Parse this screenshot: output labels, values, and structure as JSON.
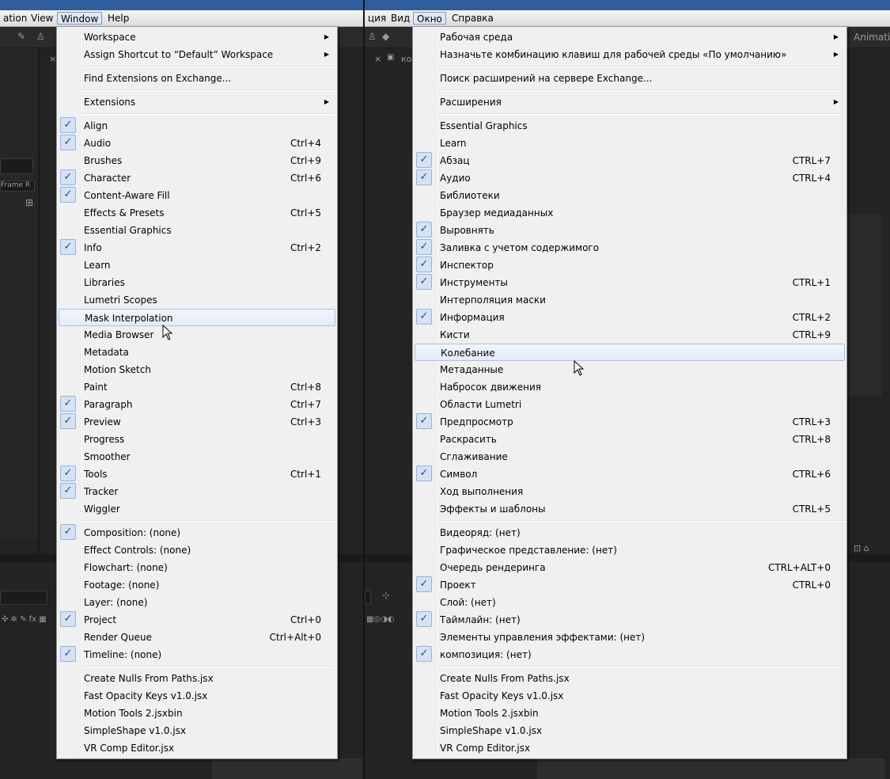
{
  "left": {
    "menubar": [
      "ation",
      "View",
      "Window",
      "Help"
    ],
    "active_menu": "Window",
    "bg_labels": {
      "frame": "Frame R",
      "x_mark": "×"
    },
    "menu": {
      "groups": [
        [
          {
            "label": "Workspace",
            "submenu": true
          },
          {
            "label": "Assign Shortcut to “Default” Workspace",
            "submenu": true
          }
        ],
        [
          {
            "label": "Find Extensions on Exchange..."
          }
        ],
        [
          {
            "label": "Extensions",
            "submenu": true
          }
        ],
        [
          {
            "label": "Align",
            "checked": true
          },
          {
            "label": "Audio",
            "checked": true,
            "shortcut": "Ctrl+4"
          },
          {
            "label": "Brushes",
            "shortcut": "Ctrl+9"
          },
          {
            "label": "Character",
            "checked": true,
            "shortcut": "Ctrl+6"
          },
          {
            "label": "Content-Aware Fill",
            "checked": true
          },
          {
            "label": "Effects & Presets",
            "shortcut": "Ctrl+5"
          },
          {
            "label": "Essential Graphics"
          },
          {
            "label": "Info",
            "checked": true,
            "shortcut": "Ctrl+2"
          },
          {
            "label": "Learn"
          },
          {
            "label": "Libraries"
          },
          {
            "label": "Lumetri Scopes"
          },
          {
            "label": "Mask Interpolation",
            "hover": true
          },
          {
            "label": "Media Browser"
          },
          {
            "label": "Metadata"
          },
          {
            "label": "Motion Sketch"
          },
          {
            "label": "Paint",
            "shortcut": "Ctrl+8"
          },
          {
            "label": "Paragraph",
            "checked": true,
            "shortcut": "Ctrl+7"
          },
          {
            "label": "Preview",
            "checked": true,
            "shortcut": "Ctrl+3"
          },
          {
            "label": "Progress"
          },
          {
            "label": "Smoother"
          },
          {
            "label": "Tools",
            "checked": true,
            "shortcut": "Ctrl+1"
          },
          {
            "label": "Tracker",
            "checked": true
          },
          {
            "label": "Wiggler"
          }
        ],
        [
          {
            "label": "Composition: (none)",
            "checked": true
          },
          {
            "label": "Effect Controls: (none)"
          },
          {
            "label": "Flowchart: (none)"
          },
          {
            "label": "Footage: (none)"
          },
          {
            "label": "Layer: (none)"
          },
          {
            "label": "Project",
            "checked": true,
            "shortcut": "Ctrl+0"
          },
          {
            "label": "Render Queue",
            "shortcut": "Ctrl+Alt+0"
          },
          {
            "label": "Timeline: (none)",
            "checked": true
          }
        ],
        [
          {
            "label": "Create Nulls From Paths.jsx"
          },
          {
            "label": "Fast Opacity Keys v1.0.jsx"
          },
          {
            "label": "Motion Tools 2.jsxbin"
          },
          {
            "label": "SimpleShape v1.0.jsx"
          },
          {
            "label": "VR Comp Editor.jsx"
          }
        ]
      ]
    }
  },
  "right": {
    "menubar": [
      "ция",
      "Вид",
      "Окно",
      "Справка"
    ],
    "active_menu": "Окно",
    "bg_labels": {
      "animation": "Animatio",
      "comp": "ко",
      "x_mark": "×"
    },
    "menu": {
      "groups": [
        [
          {
            "label": "Рабочая среда",
            "submenu": true
          },
          {
            "label": "Назначьте комбинацию клавиш для рабочей среды «По умолчанию»",
            "submenu": true
          }
        ],
        [
          {
            "label": "Поиск расширений на сервере Exchange..."
          }
        ],
        [
          {
            "label": "Расширения",
            "submenu": true
          }
        ],
        [
          {
            "label": "Essential Graphics"
          },
          {
            "label": "Learn"
          },
          {
            "label": "Абзац",
            "checked": true,
            "shortcut": "CTRL+7"
          },
          {
            "label": "Аудио",
            "checked": true,
            "shortcut": "CTRL+4"
          },
          {
            "label": "Библиотеки"
          },
          {
            "label": "Браузер медиаданных"
          },
          {
            "label": "Выровнять",
            "checked": true
          },
          {
            "label": "Заливка с учетом содержимого",
            "checked": true
          },
          {
            "label": "Инспектор",
            "checked": true
          },
          {
            "label": "Инструменты",
            "checked": true,
            "shortcut": "CTRL+1"
          },
          {
            "label": "Интерполяция маски"
          },
          {
            "label": "Информация",
            "checked": true,
            "shortcut": "CTRL+2"
          },
          {
            "label": "Кисти",
            "shortcut": "CTRL+9"
          },
          {
            "label": "Колебание",
            "hover": true
          },
          {
            "label": "Метаданные"
          },
          {
            "label": "Набросок движения"
          },
          {
            "label": "Области Lumetri"
          },
          {
            "label": "Предпросмотр",
            "checked": true,
            "shortcut": "CTRL+3"
          },
          {
            "label": "Раскрасить",
            "shortcut": "CTRL+8"
          },
          {
            "label": "Сглаживание"
          },
          {
            "label": "Символ",
            "checked": true,
            "shortcut": "CTRL+6"
          },
          {
            "label": "Ход выполнения"
          },
          {
            "label": "Эффекты и шаблоны",
            "shortcut": "CTRL+5"
          }
        ],
        [
          {
            "label": "Видеоряд: (нет)"
          },
          {
            "label": "Графическое представление: (нет)"
          },
          {
            "label": "Очередь рендеринга",
            "shortcut": "CTRL+ALT+0"
          },
          {
            "label": "Проект",
            "checked": true,
            "shortcut": "CTRL+0"
          },
          {
            "label": "Слой: (нет)"
          },
          {
            "label": "Таймлайн: (нет)",
            "checked": true
          },
          {
            "label": "Элементы управления эффектами: (нет)"
          },
          {
            "label": "композиция: (нет)",
            "checked": true
          }
        ],
        [
          {
            "label": "Create Nulls From Paths.jsx"
          },
          {
            "label": "Fast Opacity Keys v1.0.jsx"
          },
          {
            "label": "Motion Tools 2.jsxbin"
          },
          {
            "label": "SimpleShape v1.0.jsx"
          },
          {
            "label": "VR Comp Editor.jsx"
          }
        ]
      ]
    }
  },
  "icons": {
    "check": "✓",
    "submenu_arrow": "▶"
  },
  "colors": {
    "titlebar": "#2f5e9e",
    "menu_bg": "#f0f0f0",
    "check_bg": "#d5e2f3",
    "hover_border": "#a8c4e6"
  }
}
